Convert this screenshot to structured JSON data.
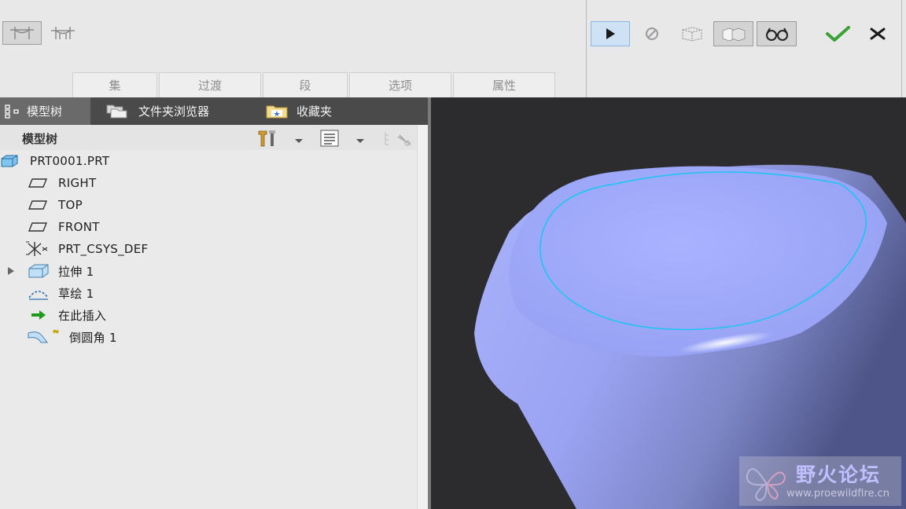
{
  "ribbon": {
    "subtabs": [
      {
        "label": "集"
      },
      {
        "label": "过渡"
      },
      {
        "label": "段"
      },
      {
        "label": "选项"
      },
      {
        "label": "属性"
      }
    ]
  },
  "panel": {
    "tabs": [
      {
        "label": "模型树",
        "icon": "model-tree-icon",
        "active": true
      },
      {
        "label": "文件夹浏览器",
        "icon": "folders-icon",
        "active": false
      },
      {
        "label": "收藏夹",
        "icon": "favorites-icon",
        "active": false
      }
    ],
    "tree_title": "模型树",
    "tree": [
      {
        "label": "PRT0001.PRT",
        "icon": "part-icon"
      },
      {
        "label": "RIGHT",
        "icon": "datum-plane-icon"
      },
      {
        "label": "TOP",
        "icon": "datum-plane-icon"
      },
      {
        "label": "FRONT",
        "icon": "datum-plane-icon"
      },
      {
        "label": "PRT_CSYS_DEF",
        "icon": "csys-icon"
      },
      {
        "label": "拉伸 1",
        "icon": "extrude-icon",
        "expandable": true
      },
      {
        "label": "草绘 1",
        "icon": "sketch-icon"
      },
      {
        "label": "在此插入",
        "icon": "insert-here-arrow-icon"
      },
      {
        "label": "倒圆角 1",
        "icon": "round-icon"
      }
    ]
  },
  "watermark": {
    "title": "野火论坛",
    "url": "www.proewildfire.cn"
  },
  "colors": {
    "accent_check": "#3aa135",
    "insert_arrow": "#1f9a1f",
    "model_face": "#9fa8f7",
    "model_edge": "#19c6f0",
    "viewport_bg": "#2c2c2e"
  }
}
